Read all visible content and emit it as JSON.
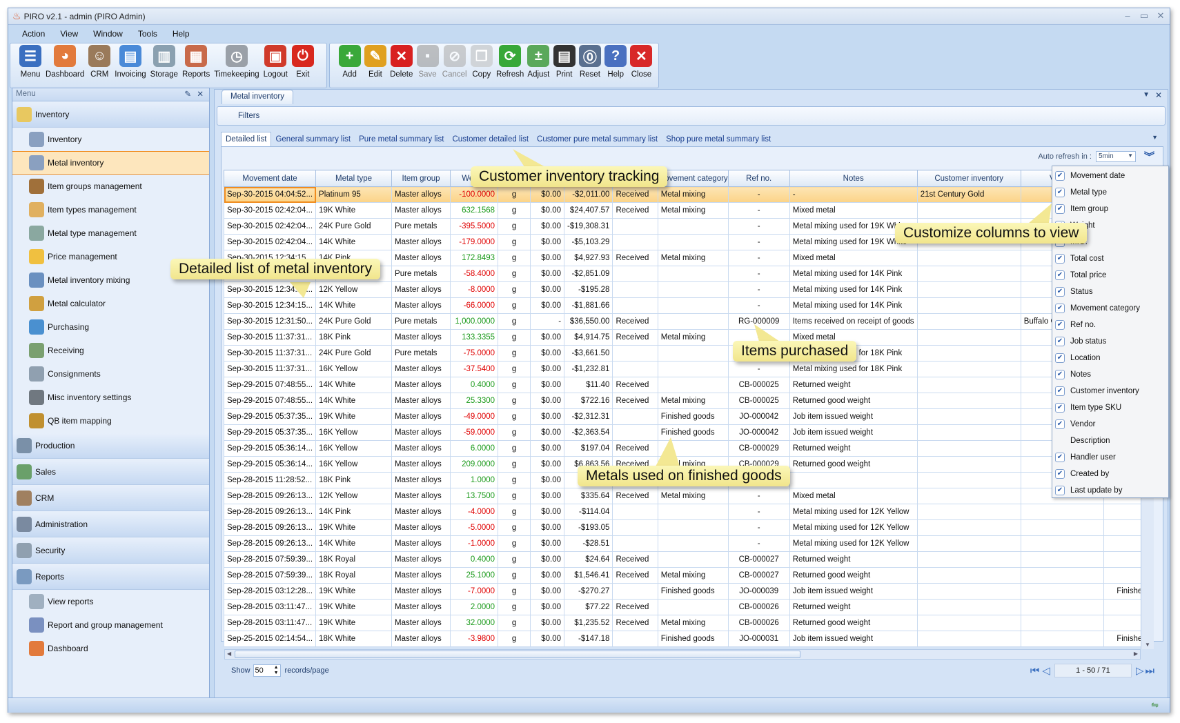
{
  "window": {
    "title": "PIRO v2.1  - admin (PIRO Admin)"
  },
  "menubar": [
    "Action",
    "View",
    "Window",
    "Tools",
    "Help"
  ],
  "toolbar_nav": [
    {
      "label": "Menu",
      "icon": "menu-icon",
      "color": "#3a6fc0",
      "glyph": "☰"
    },
    {
      "label": "Dashboard",
      "icon": "dashboard-icon",
      "color": "#e27a3c",
      "glyph": "◕"
    },
    {
      "label": "CRM",
      "icon": "crm-people-icon",
      "color": "#9a7a5a",
      "glyph": "☺"
    },
    {
      "label": "Invoicing",
      "icon": "invoice-icon",
      "color": "#4a8ad8",
      "glyph": "▤"
    },
    {
      "label": "Storage",
      "icon": "storage-icon",
      "color": "#8aa0b0",
      "glyph": "▥"
    },
    {
      "label": "Reports",
      "icon": "reports-icon",
      "color": "#c86a4a",
      "glyph": "▦"
    },
    {
      "label": "Timekeeping",
      "icon": "alarm-clock-icon",
      "color": "#9aa0a8",
      "glyph": "◷"
    },
    {
      "label": "Logout",
      "icon": "lock-icon",
      "color": "#d03a2a",
      "glyph": "▣"
    },
    {
      "label": "Exit",
      "icon": "power-icon",
      "color": "#d8281e",
      "glyph": "⏻"
    }
  ],
  "toolbar_actions": [
    {
      "label": "Add",
      "icon": "add-icon",
      "color": "#3aa83a",
      "glyph": "+",
      "enabled": true
    },
    {
      "label": "Edit",
      "icon": "pencil-icon",
      "color": "#e0a020",
      "glyph": "✎",
      "enabled": true
    },
    {
      "label": "Delete",
      "icon": "delete-x-icon",
      "color": "#d82020",
      "glyph": "✕",
      "enabled": true
    },
    {
      "label": "Save",
      "icon": "save-disk-icon",
      "color": "#9a9a9a",
      "glyph": "▪",
      "enabled": false
    },
    {
      "label": "Cancel",
      "icon": "cancel-icon",
      "color": "#b0b0b0",
      "glyph": "⊘",
      "enabled": false
    },
    {
      "label": "Copy",
      "icon": "copy-icon",
      "color": "#d0d4d8",
      "glyph": "❐",
      "enabled": true
    },
    {
      "label": "Refresh",
      "icon": "refresh-icon",
      "color": "#38a838",
      "glyph": "⟳",
      "enabled": true
    },
    {
      "label": "Adjust",
      "icon": "adjust-icon",
      "color": "#5aa85a",
      "glyph": "±",
      "enabled": true
    },
    {
      "label": "Print",
      "icon": "print-icon",
      "color": "#333333",
      "glyph": "▤",
      "enabled": true
    },
    {
      "label": "Reset",
      "icon": "reset-icon",
      "color": "#5a7090",
      "glyph": "⓪",
      "enabled": true
    },
    {
      "label": "Help",
      "icon": "help-icon",
      "color": "#4a70c0",
      "glyph": "?",
      "enabled": true
    },
    {
      "label": "Close",
      "icon": "close-circle-icon",
      "color": "#d82828",
      "glyph": "✕",
      "enabled": true
    }
  ],
  "sidebar": {
    "title": "Menu",
    "groups_top": {
      "label": "Inventory",
      "items": [
        {
          "label": "Inventory",
          "color": "#8aa0c0"
        },
        {
          "label": "Metal inventory",
          "color": "#8aa0c0",
          "selected": true
        },
        {
          "label": "Item groups management",
          "color": "#a0703a"
        },
        {
          "label": "Item types management",
          "color": "#e0b060"
        },
        {
          "label": "Metal type management",
          "color": "#8aa8a0"
        },
        {
          "label": "Price management",
          "color": "#f0c040"
        },
        {
          "label": "Metal inventory mixing",
          "color": "#6a90c0"
        },
        {
          "label": "Metal calculator",
          "color": "#d0a040"
        },
        {
          "label": "Purchasing",
          "color": "#4a90d0"
        },
        {
          "label": "Receiving",
          "color": "#7aa070"
        },
        {
          "label": "Consignments",
          "color": "#90a0b0"
        },
        {
          "label": "Misc inventory settings",
          "color": "#707880"
        },
        {
          "label": "QB item mapping",
          "color": "#c09030"
        }
      ]
    },
    "groups_mid": [
      "Production",
      "Sales",
      "CRM",
      "Administration",
      "Security"
    ],
    "reports": {
      "label": "Reports",
      "items": [
        "View reports",
        "Report and group management",
        "Dashboard"
      ]
    }
  },
  "doc_tab": "Metal inventory",
  "filters_label": "Filters",
  "subtabs": [
    "Detailed list",
    "General summary list",
    "Pure metal summary list",
    "Customer detailed list",
    "Customer pure metal summary list",
    "Shop pure metal summary list"
  ],
  "auto_refresh": {
    "label": "Auto refresh in :",
    "value": "5min"
  },
  "columns": [
    "Movement date",
    "Metal type",
    "Item group",
    "Weight",
    "",
    "M.O.",
    "Total cost",
    "Status",
    "Movement category",
    "Ref no.",
    "Notes",
    "Customer inventory",
    "Vendor",
    ""
  ],
  "rows": [
    [
      "Sep-30-2015  04:04:52...",
      "Platinum 95",
      "Master alloys",
      "-100.0000",
      "g",
      "$0.00",
      "-$2,011.00",
      "Received",
      "Metal mixing",
      "-",
      "-",
      "21st Century Gold",
      "",
      ""
    ],
    [
      "Sep-30-2015  02:42:04...",
      "19K White",
      "Master alloys",
      "632.1568",
      "g",
      "$0.00",
      "$24,407.57",
      "Received",
      "Metal mixing",
      "-",
      "Mixed metal",
      "",
      "",
      ""
    ],
    [
      "Sep-30-2015  02:42:04...",
      "24K Pure Gold",
      "Pure metals",
      "-395.5000",
      "g",
      "$0.00",
      "-$19,308.31",
      "",
      "",
      "-",
      "Metal mixing used for 19K White",
      "",
      "",
      ""
    ],
    [
      "Sep-30-2015  02:42:04...",
      "14K White",
      "Master alloys",
      "-179.0000",
      "g",
      "$0.00",
      "-$5,103.29",
      "",
      "",
      "-",
      "Metal mixing used for 19K White",
      "",
      "",
      ""
    ],
    [
      "Sep-30-2015  12:34:15...",
      "14K Pink",
      "Master alloys",
      "172.8493",
      "g",
      "$0.00",
      "$4,927.93",
      "Received",
      "Metal mixing",
      "-",
      "Mixed metal",
      "",
      "",
      ""
    ],
    [
      "Sep-30-2015  12:34:15...",
      "24K Pure Gold",
      "Pure metals",
      "-58.4000",
      "g",
      "$0.00",
      "-$2,851.09",
      "",
      "",
      "-",
      "Metal mixing used for 14K Pink",
      "",
      "",
      ""
    ],
    [
      "Sep-30-2015  12:34:15...",
      "12K Yellow",
      "Master alloys",
      "-8.0000",
      "g",
      "$0.00",
      "-$195.28",
      "",
      "",
      "-",
      "Metal mixing used for 14K Pink",
      "",
      "",
      ""
    ],
    [
      "Sep-30-2015  12:34:15...",
      "14K White",
      "Master alloys",
      "-66.0000",
      "g",
      "$0.00",
      "-$1,881.66",
      "",
      "",
      "-",
      "Metal mixing used for 14K Pink",
      "",
      "",
      ""
    ],
    [
      "Sep-30-2015  12:31:50...",
      "24K Pure Gold",
      "Pure metals",
      "1,000.0000",
      "g",
      "-",
      "$36,550.00",
      "Received",
      "",
      "RG-000009",
      "Items received on receipt of goods",
      "",
      "Buffalo Go",
      ""
    ],
    [
      "Sep-30-2015  11:37:31...",
      "18K Pink",
      "Master alloys",
      "133.3355",
      "g",
      "$0.00",
      "$4,914.75",
      "Received",
      "Metal mixing",
      "-",
      "Mixed metal",
      "",
      "",
      ""
    ],
    [
      "Sep-30-2015  11:37:31...",
      "24K Pure Gold",
      "Pure metals",
      "-75.0000",
      "g",
      "$0.00",
      "-$3,661.50",
      "",
      "",
      "-",
      "Metal mixing used for 18K Pink",
      "",
      "",
      ""
    ],
    [
      "Sep-30-2015  11:37:31...",
      "16K Yellow",
      "Master alloys",
      "-37.5400",
      "g",
      "$0.00",
      "-$1,232.81",
      "",
      "",
      "-",
      "Metal mixing used for 18K Pink",
      "",
      "",
      ""
    ],
    [
      "Sep-29-2015  07:48:55...",
      "14K White",
      "Master alloys",
      "0.4000",
      "g",
      "$0.00",
      "$11.40",
      "Received",
      "",
      "CB-000025",
      "Returned weight",
      "",
      "",
      ""
    ],
    [
      "Sep-29-2015  07:48:55...",
      "14K White",
      "Master alloys",
      "25.3300",
      "g",
      "$0.00",
      "$722.16",
      "Received",
      "Metal mixing",
      "CB-000025",
      "Returned good weight",
      "",
      "",
      ""
    ],
    [
      "Sep-29-2015  05:37:35...",
      "19K White",
      "Master alloys",
      "-49.0000",
      "g",
      "$0.00",
      "-$2,312.31",
      "",
      "Finished goods",
      "JO-000042",
      "Job item issued weight",
      "",
      "",
      ""
    ],
    [
      "Sep-29-2015  05:37:35...",
      "16K Yellow",
      "Master alloys",
      "-59.0000",
      "g",
      "$0.00",
      "-$2,363.54",
      "",
      "Finished goods",
      "JO-000042",
      "Job item issued weight",
      "",
      "",
      ""
    ],
    [
      "Sep-29-2015  05:36:14...",
      "16K Yellow",
      "Master alloys",
      "6.0000",
      "g",
      "$0.00",
      "$197.04",
      "Received",
      "",
      "CB-000029",
      "Returned weight",
      "",
      "",
      ""
    ],
    [
      "Sep-29-2015  05:36:14...",
      "16K Yellow",
      "Master alloys",
      "209.0000",
      "g",
      "$0.00",
      "$6,863.56",
      "Received",
      "Metal mixing",
      "CB-000029",
      "Returned good weight",
      "",
      "",
      ""
    ],
    [
      "Sep-28-2015  11:28:52...",
      "18K Pink",
      "Master alloys",
      "1.0000",
      "g",
      "$0.00",
      "$27.37",
      "Incoming...",
      "Returned good...",
      "",
      "",
      "",
      "",
      ""
    ],
    [
      "Sep-28-2015  09:26:13...",
      "12K Yellow",
      "Master alloys",
      "13.7500",
      "g",
      "$0.00",
      "$335.64",
      "Received",
      "Metal mixing",
      "-",
      "Mixed metal",
      "",
      "",
      ""
    ],
    [
      "Sep-28-2015  09:26:13...",
      "14K Pink",
      "Master alloys",
      "-4.0000",
      "g",
      "$0.00",
      "-$114.04",
      "",
      "",
      "-",
      "Metal mixing used for 12K Yellow",
      "",
      "",
      ""
    ],
    [
      "Sep-28-2015  09:26:13...",
      "19K White",
      "Master alloys",
      "-5.0000",
      "g",
      "$0.00",
      "-$193.05",
      "",
      "",
      "-",
      "Metal mixing used for 12K Yellow",
      "",
      "",
      ""
    ],
    [
      "Sep-28-2015  09:26:13...",
      "14K White",
      "Master alloys",
      "-1.0000",
      "g",
      "$0.00",
      "-$28.51",
      "",
      "",
      "-",
      "Metal mixing used for 12K Yellow",
      "",
      "",
      ""
    ],
    [
      "Sep-28-2015  07:59:39...",
      "18K Royal",
      "Master alloys",
      "0.4000",
      "g",
      "$0.00",
      "$24.64",
      "Received",
      "",
      "CB-000027",
      "Returned weight",
      "",
      "",
      ""
    ],
    [
      "Sep-28-2015  07:59:39...",
      "18K Royal",
      "Master alloys",
      "25.1000",
      "g",
      "$0.00",
      "$1,546.41",
      "Received",
      "Metal mixing",
      "CB-000027",
      "Returned good weight",
      "",
      "",
      ""
    ],
    [
      "Sep-28-2015  03:12:28...",
      "19K White",
      "Master alloys",
      "-7.0000",
      "g",
      "$0.00",
      "-$270.27",
      "",
      "Finished goods",
      "JO-000039",
      "Job item issued weight",
      "",
      "",
      "Finished"
    ],
    [
      "Sep-28-2015  03:11:47...",
      "19K White",
      "Master alloys",
      "2.0000",
      "g",
      "$0.00",
      "$77.22",
      "Received",
      "",
      "CB-000026",
      "Returned weight",
      "",
      "",
      ""
    ],
    [
      "Sep-28-2015  03:11:47...",
      "19K White",
      "Master alloys",
      "32.0000",
      "g",
      "$0.00",
      "$1,235.52",
      "Received",
      "Metal mixing",
      "CB-000026",
      "Returned good weight",
      "",
      "",
      ""
    ],
    [
      "Sep-25-2015  02:14:54...",
      "18K White",
      "Master alloys",
      "-3.9800",
      "g",
      "$0.00",
      "-$147.18",
      "",
      "Finished goods",
      "JO-000031",
      "Job item issued weight",
      "",
      "",
      "Finished"
    ]
  ],
  "column_chooser": [
    {
      "label": "Movement date",
      "checked": true
    },
    {
      "label": "Metal type",
      "checked": true
    },
    {
      "label": "Item group",
      "checked": true
    },
    {
      "label": "Weight",
      "checked": true
    },
    {
      "label": "M.O.",
      "checked": true
    },
    {
      "label": "Total cost",
      "checked": true
    },
    {
      "label": "Total price",
      "checked": true
    },
    {
      "label": "Status",
      "checked": true
    },
    {
      "label": "Movement category",
      "checked": true
    },
    {
      "label": "Ref no.",
      "checked": true
    },
    {
      "label": "Job status",
      "checked": true
    },
    {
      "label": "Location",
      "checked": true
    },
    {
      "label": "Notes",
      "checked": true
    },
    {
      "label": "Customer inventory",
      "checked": true
    },
    {
      "label": "Item type SKU",
      "checked": true
    },
    {
      "label": "Vendor",
      "checked": true
    },
    {
      "label": "Description",
      "checked": false
    },
    {
      "label": "Handler user",
      "checked": true
    },
    {
      "label": "Created by",
      "checked": true
    },
    {
      "label": "Last update by",
      "checked": true
    }
  ],
  "pager": {
    "show_label": "Show",
    "page_size": "50",
    "records_label": "records/page",
    "range": "1 - 50 / 71"
  },
  "callouts": {
    "customer": "Customer inventory tracking",
    "columns": "Customize columns to view",
    "detailed": "Detailed list of metal inventory",
    "purchased": "Items purchased",
    "finished": "Metals used on finished goods"
  },
  "colors": {
    "accent": "#f08c1e",
    "negative": "#e00000",
    "positive": "#1a9a1a",
    "selection": "#fbd387"
  }
}
